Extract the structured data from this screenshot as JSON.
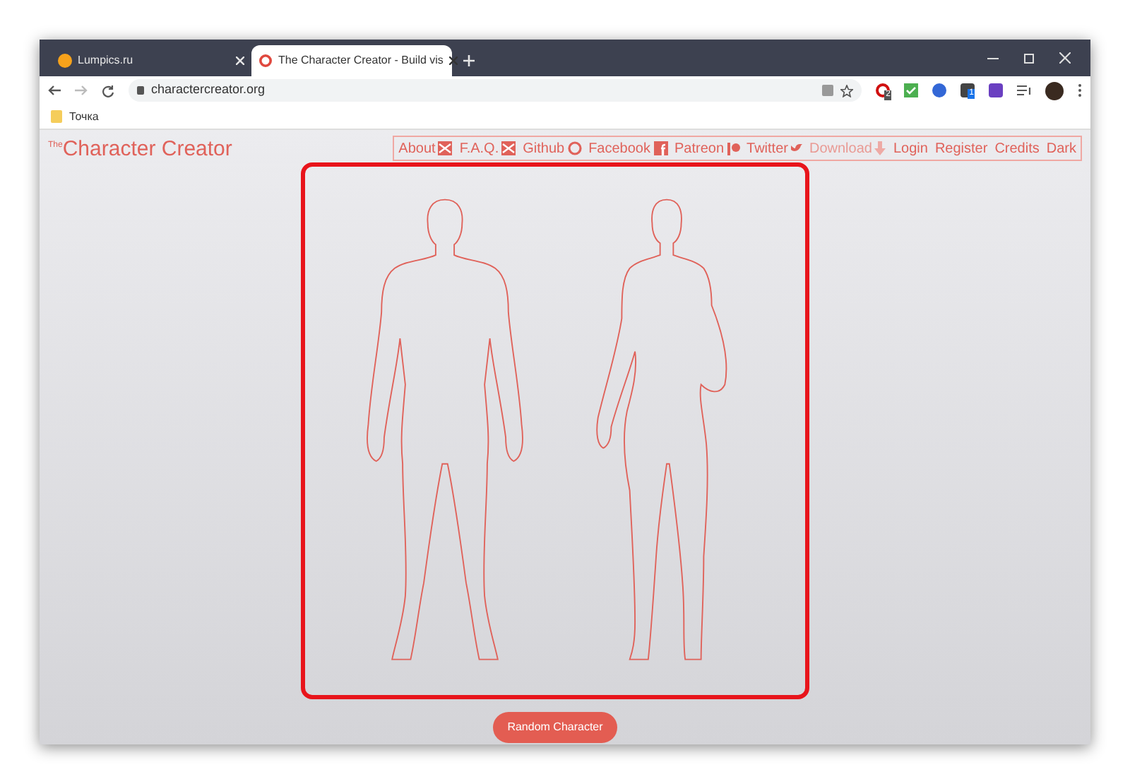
{
  "browser": {
    "tabs": [
      {
        "title": "Lumpics.ru",
        "selected": false
      },
      {
        "title": "The Character Creator - Build vis",
        "selected": true
      }
    ],
    "url": "charactercreator.org",
    "extension_badges": [
      "2",
      "1"
    ],
    "bookmarks": [
      "Точка"
    ]
  },
  "page": {
    "logo_prefix": "The",
    "logo": "Character Creator",
    "nav": [
      {
        "label": "About",
        "kind": "mail",
        "disabled": false
      },
      {
        "label": "F.A.Q.",
        "kind": "mail",
        "disabled": false
      },
      {
        "label": "Github",
        "kind": "github",
        "disabled": false
      },
      {
        "label": "Facebook",
        "kind": "facebook",
        "disabled": false
      },
      {
        "label": "Patreon",
        "kind": "patreon",
        "disabled": false
      },
      {
        "label": "Twitter",
        "kind": "twitter",
        "disabled": false
      },
      {
        "label": "Download",
        "kind": "download",
        "disabled": true
      },
      {
        "label": "Login",
        "kind": "text",
        "disabled": false
      },
      {
        "label": "Register",
        "kind": "text",
        "disabled": false
      },
      {
        "label": "Credits",
        "kind": "text",
        "disabled": false
      },
      {
        "label": "Dark",
        "kind": "text",
        "disabled": false
      }
    ],
    "random_button": "Random Character"
  }
}
